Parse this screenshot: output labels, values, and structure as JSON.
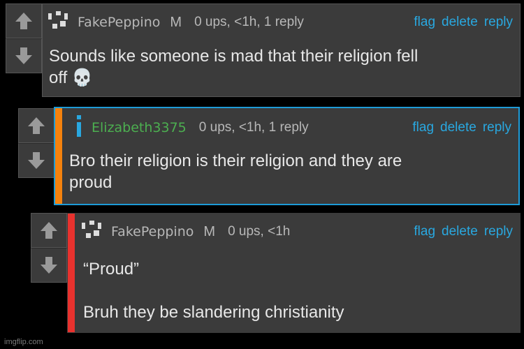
{
  "comments": [
    {
      "username": "FakePeppino",
      "badge": "M",
      "meta": "0 ups, <1h, 1 reply",
      "body_lines": [
        "Sounds like someone is mad that their religion fell",
        "off 💀"
      ],
      "avatar_icon": "pixel-face-icon",
      "bar_color": ""
    },
    {
      "username": "Elizabeth3375",
      "badge": "",
      "meta": "0 ups, <1h, 1 reply",
      "body_lines": [
        "Bro their religion is their religion and they are",
        "proud"
      ],
      "avatar_icon": "info-i-icon",
      "bar_color": "#f5820d",
      "highlight_color": "#1e9bd7"
    },
    {
      "username": "FakePeppino",
      "badge": "M",
      "meta": "0 ups, <1h",
      "body_lines": [
        "“Proud”",
        "",
        "Bruh they be slandering christianity"
      ],
      "avatar_icon": "pixel-face-icon",
      "bar_color": "#e8322e"
    }
  ],
  "actions": {
    "flag": "flag",
    "delete": "delete",
    "reply": "reply"
  },
  "watermark": "imgflip.com"
}
